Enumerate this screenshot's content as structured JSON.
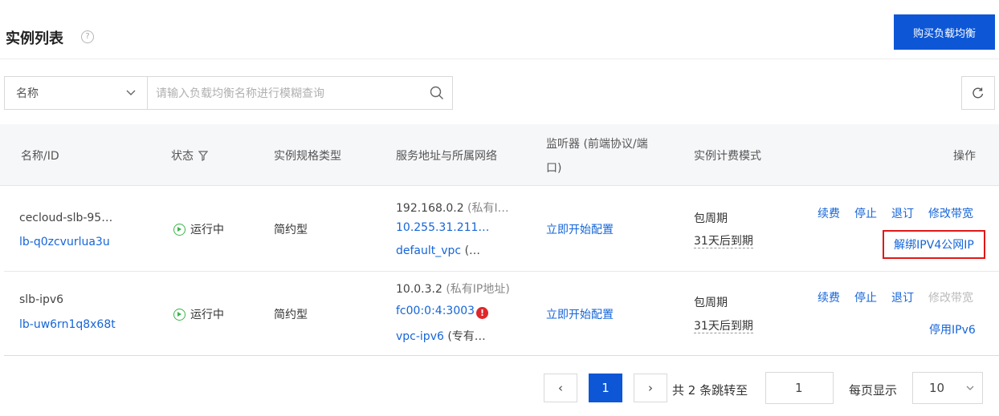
{
  "header": {
    "title": "实例列表",
    "help_icon": "?",
    "buy_button": "购买负载均衡"
  },
  "filter": {
    "selected": "名称",
    "search_placeholder": "请输入负载均衡名称进行模糊查询"
  },
  "table": {
    "columns": {
      "name": "名称/ID",
      "status": "状态",
      "spec": "实例规格类型",
      "address": "服务地址与所属网络",
      "listener_1": "监听器 (前端协议/端",
      "listener_2": "口)",
      "billing": "实例计费模式",
      "ops": "操作"
    },
    "rows": [
      {
        "name": "cecloud-slb-95…",
        "id": "lb-q0zcvurlua3u",
        "status": "运行中",
        "spec": "简约型",
        "addr_private_ip": "192.168.0.2",
        "addr_private_note": " (私有I…",
        "addr_2": "10.255.31.211…",
        "addr_vpc": "default_vpc",
        "addr_vpc_note": " (…",
        "listener": "立即开始配置",
        "billing": "包周期",
        "expire": "31天后到期",
        "ops": {
          "renew": "续费",
          "stop": "停止",
          "unsubscribe": "退订",
          "modify_bw": "修改带宽",
          "extra": "解绑IPV4公网IP"
        }
      },
      {
        "name": "slb-ipv6",
        "id": "lb-uw6rn1q8x68t",
        "status": "运行中",
        "spec": "简约型",
        "addr_private_ip": "10.0.3.2",
        "addr_private_note": " (私有IP地址)",
        "addr_2": "fc00:0:4:3003",
        "addr_2_badge": "!",
        "addr_vpc": "vpc-ipv6",
        "addr_vpc_note": " (专有…",
        "listener": "立即开始配置",
        "billing": "包周期",
        "expire": "31天后到期",
        "ops": {
          "renew": "续费",
          "stop": "停止",
          "unsubscribe": "退订",
          "modify_bw": "修改带宽",
          "extra": "停用IPv6"
        }
      }
    ]
  },
  "pagination": {
    "prev": "‹",
    "current": "1",
    "next": "›",
    "total_text": "共 2 条跳转至",
    "jump_value": "1",
    "per_page_label": "每页显示",
    "per_page_value": "10"
  },
  "colors": {
    "primary": "#0d57d6",
    "link": "#1565d8",
    "running": "#3bb54a",
    "error": "#e0262b",
    "highlight_border": "#e01818"
  }
}
